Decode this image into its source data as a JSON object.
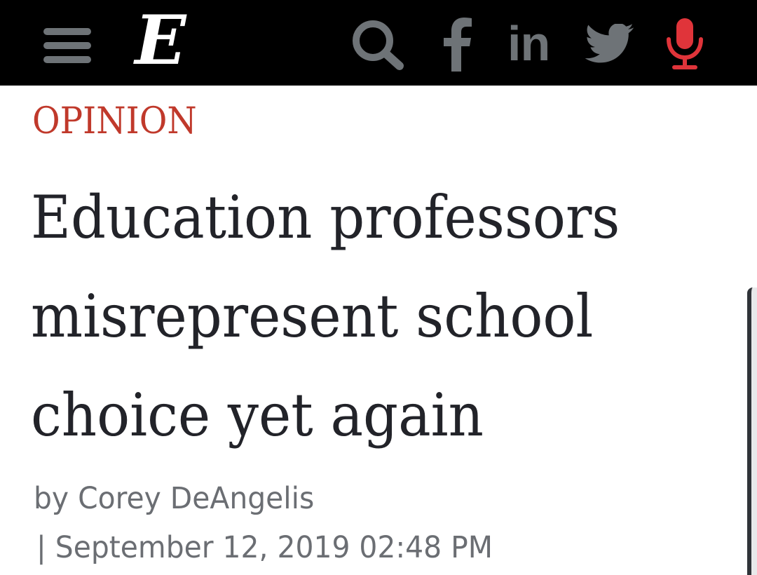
{
  "header": {
    "logo_letter": "E",
    "icons": [
      "menu-icon",
      "search-icon",
      "facebook-icon",
      "linkedin-icon",
      "twitter-icon",
      "mic-icon"
    ],
    "linkedin_text": "in",
    "colors": {
      "bar": "#000000",
      "icon": "#6e7377",
      "mic": "#e0343a"
    }
  },
  "article": {
    "section": "OPINION",
    "headline_lines": [
      "Education professors",
      "misrepresent school",
      "choice yet again"
    ],
    "byline_prefix": "by",
    "author": "Corey DeAngelis",
    "date_separator": "|",
    "date": "September 12, 2019 02:48 PM"
  },
  "colors": {
    "section": "#c0392b",
    "headline": "#222329",
    "meta": "#6b6e73"
  }
}
